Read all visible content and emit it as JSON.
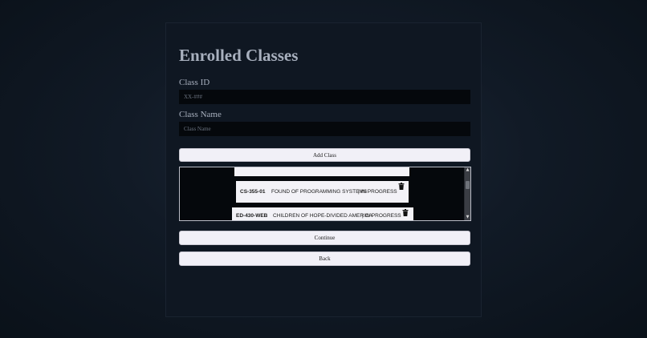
{
  "page": {
    "title": "Enrolled Classes"
  },
  "form": {
    "class_id_label": "Class ID",
    "class_id_placeholder": "XX-###",
    "class_name_label": "Class Name",
    "class_name_placeholder": "Class Name",
    "add_button": "Add Class"
  },
  "classes": [
    {
      "code": "CS-355-01",
      "name": "FOUND OF PROGRAMMING SYSTEMS",
      "status": "| IN PROGRESS"
    },
    {
      "code": "ED-430-WEB",
      "name": "CHILDREN OF HOPE-DIVIDED AMERICA",
      "status": "| IN PROGRESS"
    }
  ],
  "actions": {
    "continue": "Continue",
    "back": "Back"
  },
  "colors": {
    "background": "#111a26",
    "panel": "#0f1722",
    "button": "#f1f0f7",
    "title": "#a8b0be"
  },
  "icons": {
    "delete": "trash-icon",
    "scroll_up": "scroll-up-arrow",
    "scroll_down": "scroll-down-arrow"
  }
}
